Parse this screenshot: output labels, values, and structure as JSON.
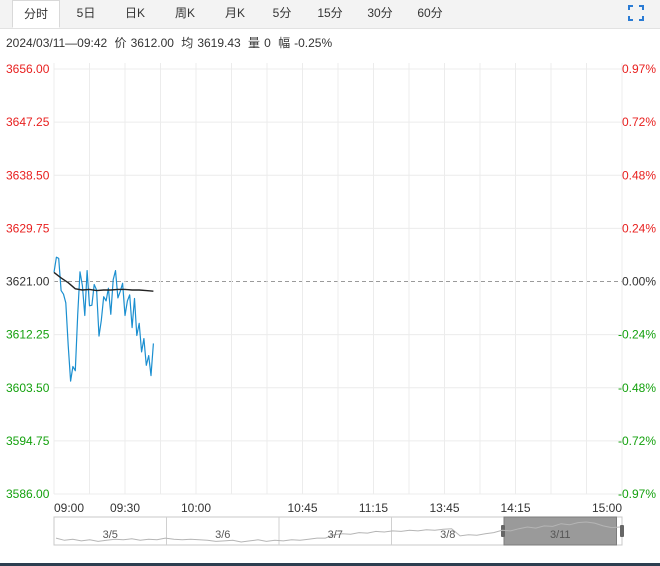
{
  "tabs": [
    {
      "label": "分时",
      "active": true
    },
    {
      "label": "5日"
    },
    {
      "label": "日K"
    },
    {
      "label": "周K"
    },
    {
      "label": "月K"
    },
    {
      "label": "5分"
    },
    {
      "label": "15分"
    },
    {
      "label": "30分"
    },
    {
      "label": "60分"
    }
  ],
  "info": {
    "datetime": "2024/03/11—09:42",
    "price_label": "价",
    "price": "3612.00",
    "avg_label": "均",
    "avg": "3619.43",
    "vol_label": "量",
    "vol": "0",
    "chg_label": "幅",
    "chg": "-0.25%"
  },
  "colors": {
    "up": "#e8201f",
    "down": "#14a10e",
    "price_line": "#1b8fd0",
    "avg_line": "#222222",
    "grid": "#ececec"
  },
  "chart_data": {
    "type": "line",
    "prev_close": 3621.0,
    "ylim": [
      3586.0,
      3656.0
    ],
    "y_ticks_left": [
      "3656.00",
      "3647.25",
      "3638.50",
      "3629.75",
      "3621.00",
      "3612.25",
      "3603.50",
      "3594.75",
      "3586.00"
    ],
    "y_ticks_right": [
      "0.97%",
      "0.72%",
      "0.48%",
      "0.24%",
      "0.00%",
      "-0.24%",
      "-0.48%",
      "-0.72%",
      "-0.97%"
    ],
    "x_ticks": [
      "09:00",
      "09:30",
      "10:00",
      "10:45",
      "11:15",
      "13:45",
      "14:15",
      "15:00"
    ],
    "x_minutes": [
      0,
      30,
      60,
      105,
      135,
      165,
      195,
      240
    ],
    "series": [
      {
        "key": "price",
        "minutes": [
          0,
          1,
          2,
          3,
          4,
          5,
          6,
          7,
          8,
          9,
          10,
          11,
          12,
          13,
          14,
          15,
          16,
          17,
          18,
          19,
          20,
          21,
          22,
          23,
          24,
          25,
          26,
          27,
          28,
          29,
          30,
          31,
          32,
          33,
          34,
          35,
          36,
          37,
          38,
          39,
          40,
          41,
          42
        ],
        "values": [
          3622.5,
          3625.0,
          3624.8,
          3619.5,
          3618.9,
          3617.5,
          3610.5,
          3604.6,
          3607.0,
          3606.3,
          3615.5,
          3622.6,
          3620.3,
          3615.4,
          3622.8,
          3617.0,
          3617.1,
          3620.5,
          3619.6,
          3612.0,
          3614.6,
          3618.5,
          3617.8,
          3619.9,
          3615.6,
          3621.3,
          3622.8,
          3618.3,
          3619.4,
          3620.7,
          3615.4,
          3617.8,
          3618.8,
          3613.4,
          3618.2,
          3612.1,
          3614.1,
          3609.4,
          3611.6,
          3607.2,
          3608.8,
          3605.5,
          3610.8
        ]
      },
      {
        "key": "avg",
        "minutes": [
          0,
          3,
          6,
          9,
          12,
          15,
          18,
          21,
          24,
          27,
          30,
          33,
          36,
          39,
          42
        ],
        "values": [
          3622.5,
          3621.6,
          3620.8,
          3619.8,
          3619.6,
          3619.7,
          3619.5,
          3619.6,
          3619.6,
          3619.7,
          3619.7,
          3619.6,
          3619.6,
          3619.5,
          3619.4
        ]
      }
    ],
    "navigator": {
      "labels": [
        "3/5",
        "3/6",
        "3/7",
        "3/8",
        "3/11"
      ],
      "values": [
        3592,
        3588,
        3590,
        3587,
        3589,
        3586,
        3588,
        3590,
        3589,
        3591,
        3588,
        3590,
        3589,
        3592,
        3590,
        3589,
        3590,
        3589,
        3588,
        3586,
        3587,
        3588,
        3585,
        3587,
        3589,
        3586,
        3588,
        3587,
        3589,
        3588,
        3590,
        3592,
        3592,
        3598,
        3600,
        3599,
        3602,
        3601,
        3604,
        3603,
        3605,
        3604,
        3606,
        3605,
        3607,
        3606,
        3608,
        3609,
        3596,
        3598,
        3597,
        3600,
        3602,
        3606,
        3605,
        3609,
        3612,
        3610,
        3614,
        3613,
        3618,
        3616,
        3620,
        3621,
        3619,
        3614,
        3611,
        3612
      ]
    }
  }
}
